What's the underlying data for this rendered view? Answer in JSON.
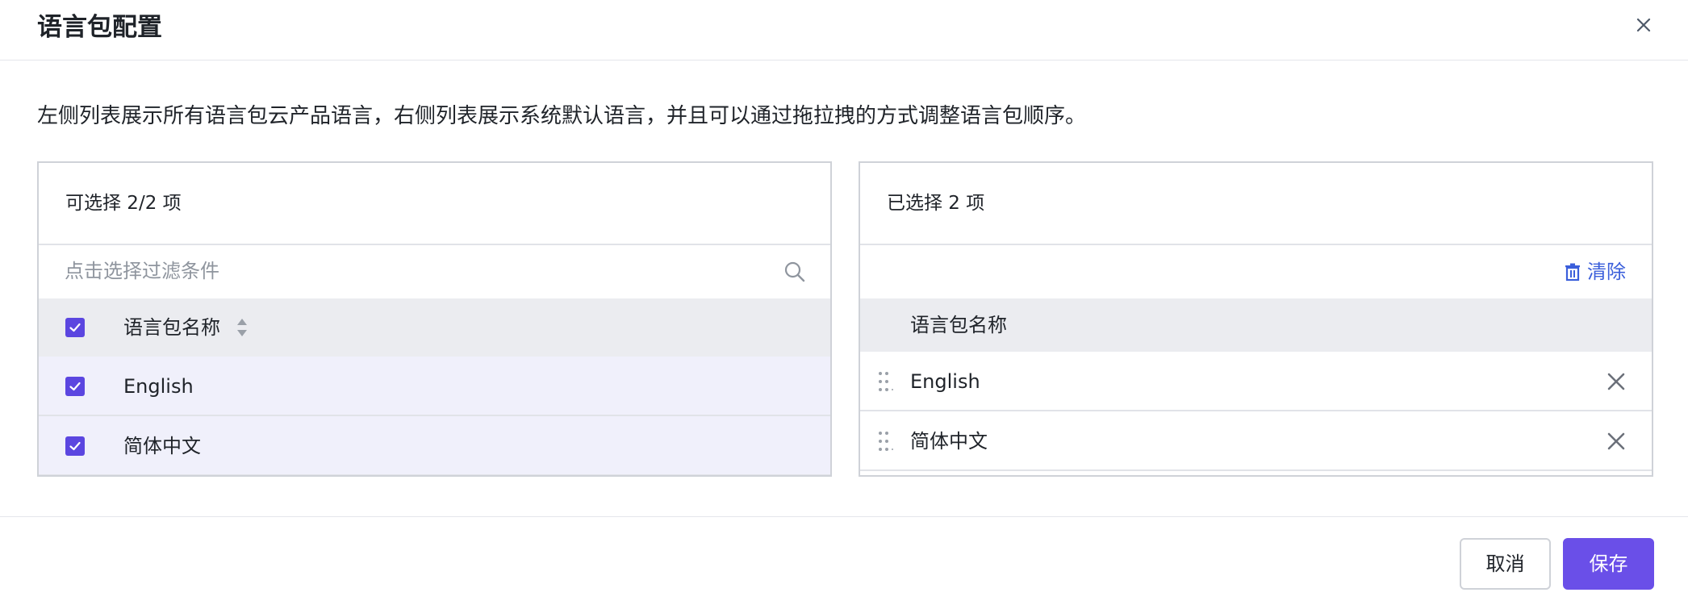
{
  "dialog": {
    "title": "语言包配置",
    "description": "左侧列表展示所有语言包云产品语言，右侧列表展示系统默认语言，并且可以通过拖拉拽的方式调整语言包顺序。"
  },
  "left_panel": {
    "header": "可选择 2/2 项",
    "search_placeholder": "点击选择过滤条件",
    "column_header": "语言包名称",
    "rows": [
      {
        "name": "English"
      },
      {
        "name": "简体中文"
      }
    ]
  },
  "right_panel": {
    "header": "已选择 2 项",
    "clear_label": "清除",
    "column_header": "语言包名称",
    "rows": [
      {
        "name": "English"
      },
      {
        "name": "简体中文"
      }
    ]
  },
  "footer": {
    "cancel_label": "取消",
    "save_label": "保存"
  },
  "colors": {
    "accent": "#6a4fe8",
    "checkbox": "#5b46e0",
    "link": "#3b5fdb",
    "selected_row": "#f0f0fb",
    "table_header": "#ebecf0"
  },
  "icons": [
    "close-icon",
    "search-icon",
    "sort-icon",
    "check-icon",
    "trash-icon",
    "drag-handle-icon",
    "remove-icon"
  ]
}
